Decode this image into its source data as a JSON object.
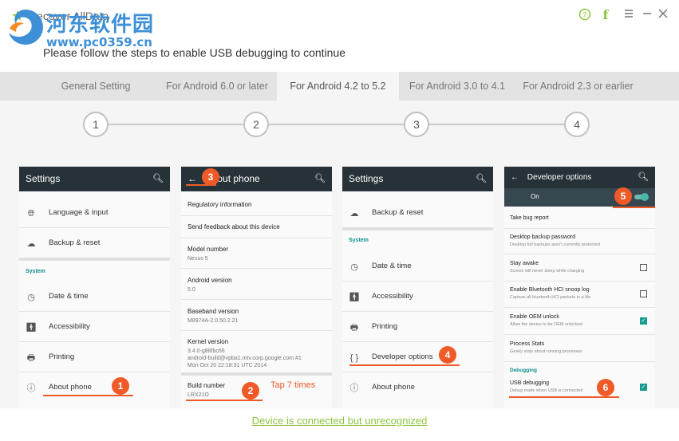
{
  "app": {
    "title": "Recover AllData",
    "watermark_cn": "河东软件园",
    "watermark_url": "www.pc0359.cn"
  },
  "instruction": "Please follow the steps to enable USB debugging to continue",
  "tabs": [
    {
      "label": "General Setting"
    },
    {
      "label": "For Android 6.0 or later"
    },
    {
      "label": "For Android 4.2 to 5.2"
    },
    {
      "label": "For Android 3.0 to 4.1"
    },
    {
      "label": "For Android 2.3 or earlier"
    }
  ],
  "steps": [
    "1",
    "2",
    "3",
    "4"
  ],
  "panel1": {
    "title": "Settings",
    "items": [
      "Language & input",
      "Backup & reset"
    ],
    "section": "System",
    "system_items": [
      "Date & time",
      "Accessibility",
      "Printing",
      "About phone"
    ],
    "badge": "1"
  },
  "panel2": {
    "title": "About phone",
    "rows": [
      "Regulatory information",
      "Send feedback about this device"
    ],
    "model_label": "Model number",
    "model_value": "Nexus 5",
    "android_label": "Android version",
    "android_value": "5.0",
    "baseband_label": "Baseband version",
    "baseband_value": "M8974A-2.0.50.2.21",
    "kernel_label": "Kernel version",
    "kernel_value_1": "3.4.0-g88fbc66",
    "kernel_value_2": "android-build@vpba1.mtv.corp.google.com #1",
    "kernel_value_3": "Mon Oct 20 22:18:31 UTC 2014",
    "build_label": "Build number",
    "build_value": "LRX21O",
    "tap_hint": "Tap 7 times",
    "badge_back": "3",
    "badge_build": "2"
  },
  "panel3": {
    "title": "Settings",
    "items": [
      "Backup & reset"
    ],
    "section": "System",
    "system_items": [
      "Date & time",
      "Accessibility",
      "Printing",
      "Developer options",
      "About phone"
    ],
    "badge": "4"
  },
  "panel4": {
    "title": "Developer options",
    "toggle_label": "On",
    "badge_on": "5",
    "rows": [
      {
        "title": "Take bug report",
        "sub": ""
      },
      {
        "title": "Desktop backup password",
        "sub": "Desktop full backups aren't currently protected"
      },
      {
        "title": "Stay awake",
        "sub": "Screen will never sleep while charging"
      },
      {
        "title": "Enable Bluetooth HCI snoop log",
        "sub": "Capture all bluetooth HCI packets in a file"
      },
      {
        "title": "Enable OEM unlock",
        "sub": "Allow the device to be OEM unlocked"
      },
      {
        "title": "Process Stats",
        "sub": "Geeky stats about running processes"
      }
    ],
    "section": "Debugging",
    "usb_title": "USB debugging",
    "usb_sub": "Debug mode when USB is connected",
    "badge_usb": "6"
  },
  "status": "Device is connected but unrecognized",
  "colors": {
    "accent_green": "#8cc63f",
    "badge_orange": "#ef5a28",
    "android_bar": "#263238",
    "teal": "#179c8e"
  }
}
